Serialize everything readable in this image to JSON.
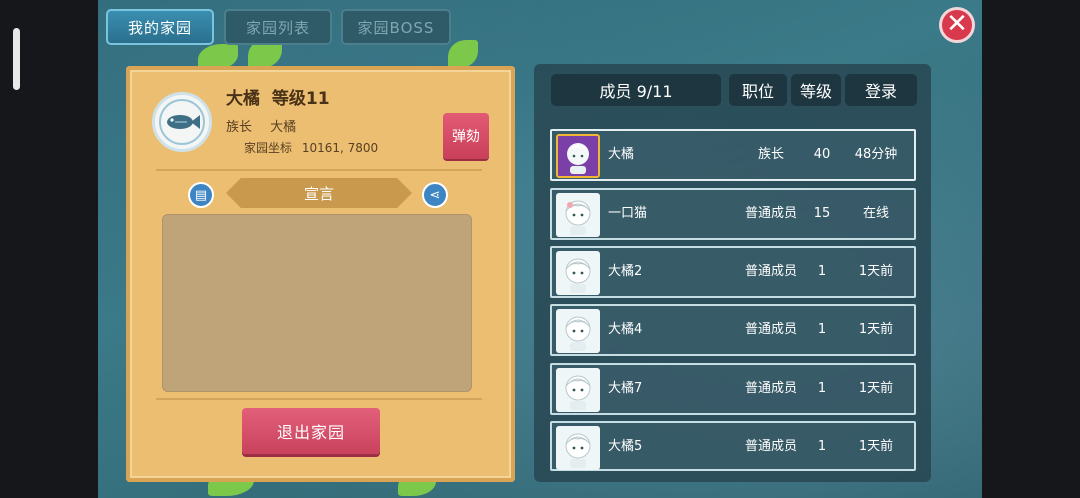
{
  "tabs": [
    {
      "label": "我的家园",
      "active": true
    },
    {
      "label": "家园列表",
      "active": false
    },
    {
      "label": "家园BOSS",
      "active": false
    }
  ],
  "close_icon": "close-icon",
  "home": {
    "name": "大橘",
    "level_text": "等级11",
    "leader_label": "族长",
    "leader_name": "大橘",
    "coords_label": "家园坐标",
    "coords_value": "10161, 7800",
    "emblem_icon": "fish-icon",
    "impeach_label": "弹劾",
    "declaration_label": "宣言",
    "declaration_text": "",
    "leave_label": "退出家园"
  },
  "members_panel": {
    "count_label": "成员 9/11",
    "col_position": "职位",
    "col_level": "等级",
    "col_login": "登录",
    "members": [
      {
        "name": "大橘",
        "position": "族长",
        "level": "40",
        "login": "48分钟"
      },
      {
        "name": "一口猫",
        "position": "普通成员",
        "level": "15",
        "login": "在线"
      },
      {
        "name": "大橘2",
        "position": "普通成员",
        "level": "1",
        "login": "1天前"
      },
      {
        "name": "大橘4",
        "position": "普通成员",
        "level": "1",
        "login": "1天前"
      },
      {
        "name": "大橘7",
        "position": "普通成员",
        "level": "1",
        "login": "1天前"
      },
      {
        "name": "大橘5",
        "position": "普通成员",
        "level": "1",
        "login": "1天前"
      }
    ]
  },
  "colors": {
    "panel_wood": "#ebbe72",
    "accent_red": "#d9394c",
    "active_tab": "#3a8fb0"
  }
}
